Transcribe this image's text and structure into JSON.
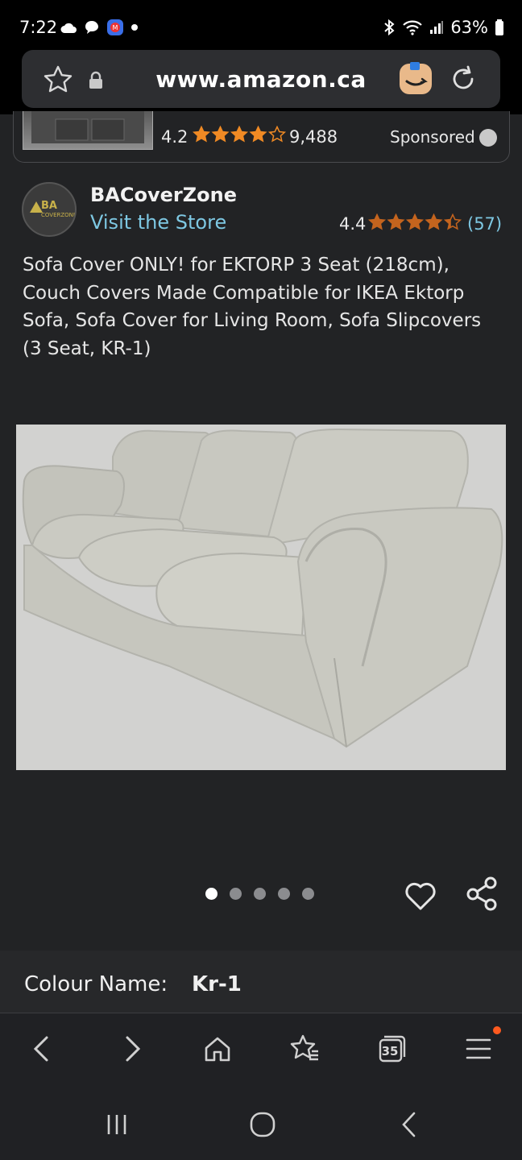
{
  "status_bar": {
    "time": "7:22",
    "battery": "63%"
  },
  "url_bar": {
    "url": "www.amazon.ca"
  },
  "sponsored_item": {
    "rating": "4.2",
    "stars": 4.2,
    "review_count": "9,488",
    "sponsored_label": "Sponsored"
  },
  "seller": {
    "name": "BACoverZone",
    "visit_store": "Visit the Store",
    "rating": "4.4",
    "stars": 4.4,
    "review_count": "(57)",
    "logo_text": "BA",
    "logo_subtext": "COVERZONE"
  },
  "product": {
    "title": "Sofa Cover ONLY! for EKTORP 3 Seat (218cm), Couch Covers Made Compatible for IKEA Ektorp Sofa, Sofa Cover for Living Room, Sofa Slipcovers (3 Seat, KR-1)"
  },
  "gallery": {
    "image_count": 5,
    "active_index": 0
  },
  "colour": {
    "label": "Colour Name:",
    "value": "Kr-1"
  },
  "browser_nav": {
    "tabs_count": "35"
  },
  "colors": {
    "background": "#222325",
    "link": "#7ec8e3",
    "star": "#f08a24",
    "accent_dot": "#ff5a1f"
  }
}
